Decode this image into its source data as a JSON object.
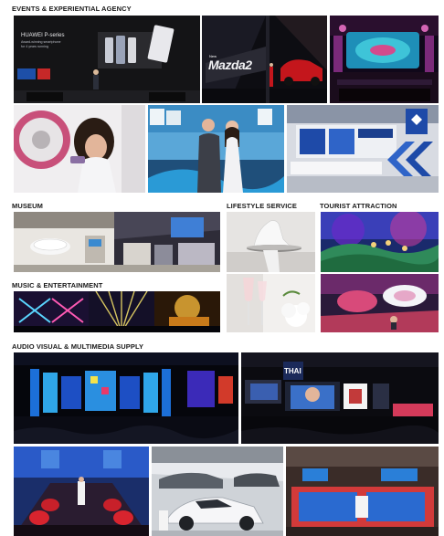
{
  "sections": {
    "events": "EVENTS & EXPERIENTIAL AGENCY",
    "museum": "MUSEUM",
    "lifestyle": "LIFESTYLE SERVICE",
    "tourist": "TOURIST ATTRACTION",
    "music": "MUSIC & ENTERTAINMENT",
    "audio_visual": "AUDIO VISUAL & MULTIMEDIA SUPPLY"
  },
  "photo_text": {
    "huawei_title": "HUAWEI P-series",
    "huawei_sub1": "Award-winning smartphone",
    "huawei_sub2": "for 4 years running",
    "mazda_logo": "Mazda2",
    "mazda_new": "New",
    "thai_sign": "THAI"
  },
  "colors": {
    "heading": "#1a1a1a",
    "stage_blue": "#1c6fd8",
    "stage_red": "#d23a2a"
  }
}
